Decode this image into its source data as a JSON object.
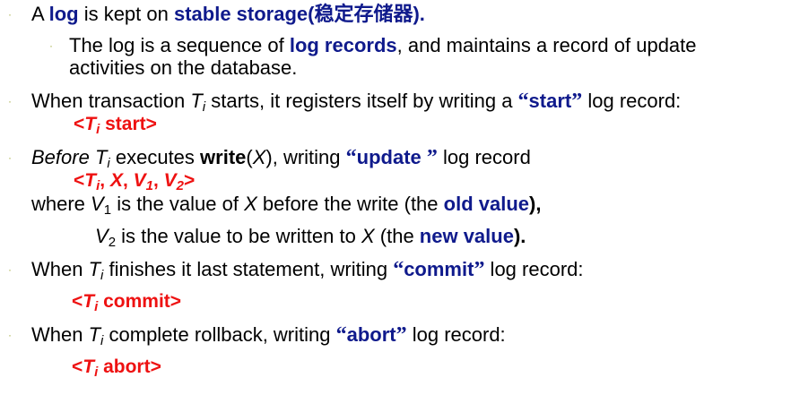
{
  "colors": {
    "keyword_blue": "#0f1a8c",
    "record_red": "#ee1111",
    "bullet_olive": "#a8b04a"
  },
  "bullet_glyph": "·",
  "b1": {
    "a": "A ",
    "kw1": "log",
    "b": " is kept on ",
    "kw2": "stable storage(稳定存储器).",
    "c": ""
  },
  "b1s": {
    "a": "The log is a sequence of ",
    "kw": "log records",
    "b": ", and maintains a record of update",
    "line2": "activities on the database."
  },
  "b2": {
    "a": "When transaction ",
    "T": "T",
    "i": "i",
    "b": " starts, it registers itself by writing a ",
    "q1": "“",
    "kw": "start",
    "q2": "”",
    "c": " log record:"
  },
  "rec_start": {
    "lt": "<",
    "T": "T",
    "i": "i",
    "rest": " start>"
  },
  "b3": {
    "before": "Before",
    "sp": " ",
    "T": "T",
    "i": "i",
    "a": " executes ",
    "write": "write",
    "p1": "(",
    "X": "X",
    "p2": "), writing ",
    "q1": "“",
    "kw": "update ",
    "q2": "”",
    "c": " log record"
  },
  "rec_update": {
    "lt": "<",
    "T": "T",
    "i": "i",
    "sep1": ", ",
    "X": "X",
    "sep2": ",  ",
    "V1": "V",
    "one": "1",
    "sep3": ",  ",
    "V2": "V",
    "two": "2",
    "gt": ">"
  },
  "where1": {
    "a": "where ",
    "V": "V",
    "sub": "1",
    "b": " is the value of ",
    "X": "X",
    "c": "  before the write (the ",
    "kw": "old value",
    "d": "),"
  },
  "where2": {
    "V": "V",
    "sub": "2",
    "b": " is the value to be written to ",
    "X": "X",
    "c": " (the ",
    "kw": "new value",
    "d": ")."
  },
  "b4": {
    "a": "When ",
    "T": "T",
    "i": "i",
    "b": " finishes it last statement, writing ",
    "q1": "“",
    "kw": "commit",
    "q2": "”",
    "c": " log record:"
  },
  "rec_commit": {
    "lt": "<",
    "T": "T",
    "i": "i",
    "rest": "  commit>"
  },
  "b5": {
    "a": "When ",
    "T": "T",
    "i": "i",
    "b": "  complete rollback, writing ",
    "q1": "“",
    "kw": "abort",
    "q2": "”",
    "c": " log record:"
  },
  "rec_abort": {
    "lt": "<",
    "T": "T",
    "i": "i",
    "rest": "  abort>"
  }
}
